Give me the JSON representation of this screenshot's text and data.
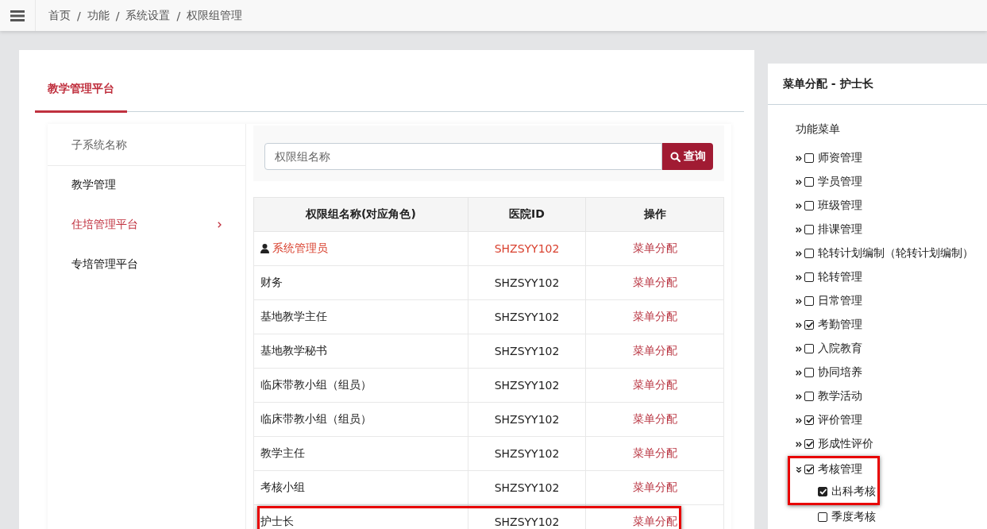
{
  "breadcrumb": [
    "首页",
    "功能",
    "系统设置",
    "权限组管理"
  ],
  "breadcrumb_separator": "/",
  "tabs": [
    {
      "label": "教学管理平台",
      "selected": true
    }
  ],
  "subsystems": {
    "header": "子系统名称",
    "items": [
      {
        "label": "教学管理",
        "selected": false
      },
      {
        "label": "住培管理平台",
        "selected": true
      },
      {
        "label": "专培管理平台",
        "selected": false
      }
    ]
  },
  "search": {
    "placeholder": "权限组名称",
    "button": "查询"
  },
  "table": {
    "columns": [
      "权限组名称(对应角色)",
      "医院ID",
      "操作"
    ],
    "rows": [
      {
        "name": "系统管理员",
        "hospital_id": "SHZSYY102",
        "action": "菜单分配",
        "admin": true,
        "highlighted": false
      },
      {
        "name": "财务",
        "hospital_id": "SHZSYY102",
        "action": "菜单分配",
        "admin": false,
        "highlighted": false
      },
      {
        "name": "基地教学主任",
        "hospital_id": "SHZSYY102",
        "action": "菜单分配",
        "admin": false,
        "highlighted": false
      },
      {
        "name": "基地教学秘书",
        "hospital_id": "SHZSYY102",
        "action": "菜单分配",
        "admin": false,
        "highlighted": false
      },
      {
        "name": "临床带教小组（组员）",
        "hospital_id": "SHZSYY102",
        "action": "菜单分配",
        "admin": false,
        "highlighted": false
      },
      {
        "name": "临床带教小组（组员）",
        "hospital_id": "SHZSYY102",
        "action": "菜单分配",
        "admin": false,
        "highlighted": false
      },
      {
        "name": "教学主任",
        "hospital_id": "SHZSYY102",
        "action": "菜单分配",
        "admin": false,
        "highlighted": false
      },
      {
        "name": "考核小组",
        "hospital_id": "SHZSYY102",
        "action": "菜单分配",
        "admin": false,
        "highlighted": false
      },
      {
        "name": "护士长",
        "hospital_id": "SHZSYY102",
        "action": "菜单分配",
        "admin": false,
        "highlighted": true
      }
    ]
  },
  "menu_panel": {
    "title": "菜单分配 - 护士长",
    "root": "功能菜单",
    "items": [
      {
        "label": "师资管理",
        "checked": false,
        "expanded": false,
        "highlighted": false
      },
      {
        "label": "学员管理",
        "checked": false,
        "expanded": false,
        "highlighted": false
      },
      {
        "label": "班级管理",
        "checked": false,
        "expanded": false,
        "highlighted": false
      },
      {
        "label": "排课管理",
        "checked": false,
        "expanded": false,
        "highlighted": false
      },
      {
        "label": "轮转计划编制（轮转计划编制）",
        "checked": false,
        "expanded": false,
        "highlighted": false
      },
      {
        "label": "轮转管理",
        "checked": false,
        "expanded": false,
        "highlighted": false
      },
      {
        "label": "日常管理",
        "checked": false,
        "expanded": false,
        "highlighted": false
      },
      {
        "label": "考勤管理",
        "checked": true,
        "expanded": false,
        "highlighted": false
      },
      {
        "label": "入院教育",
        "checked": false,
        "expanded": false,
        "highlighted": false
      },
      {
        "label": "协同培养",
        "checked": false,
        "expanded": false,
        "highlighted": false
      },
      {
        "label": "教学活动",
        "checked": false,
        "expanded": false,
        "highlighted": false
      },
      {
        "label": "评价管理",
        "checked": true,
        "expanded": false,
        "highlighted": false
      },
      {
        "label": "形成性评价",
        "checked": true,
        "expanded": false,
        "highlighted": false
      },
      {
        "label": "考核管理",
        "checked": true,
        "expanded": true,
        "highlighted": true,
        "children": [
          {
            "label": "出科考核",
            "checked": true,
            "highlighted": true
          },
          {
            "label": "季度考核",
            "checked": false,
            "highlighted": false
          }
        ]
      }
    ]
  }
}
